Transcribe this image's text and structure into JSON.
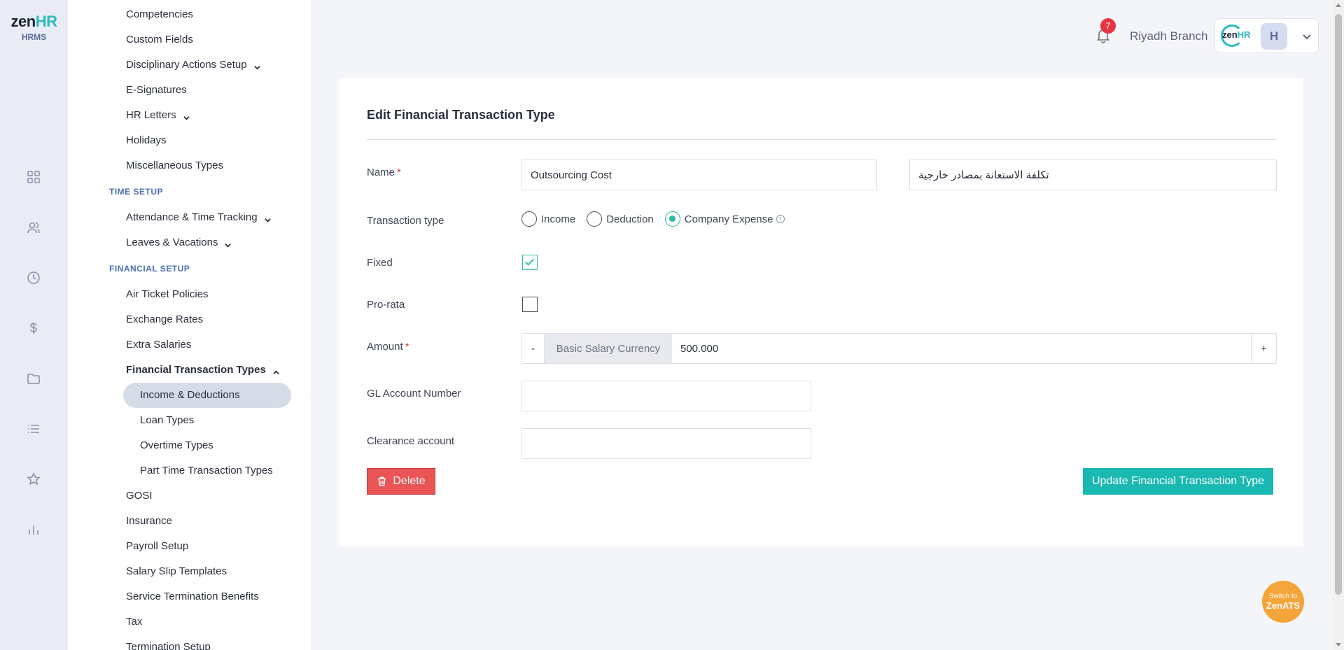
{
  "brand": {
    "logo_main": "zen",
    "logo_accent": "HR",
    "logo_sub": "HRMS"
  },
  "rail_icons": [
    "dashboard-icon",
    "people-icon",
    "clock-icon",
    "dollar-icon",
    "folder-icon",
    "list-icon",
    "star-icon",
    "bar-chart-icon"
  ],
  "sidebar": {
    "items": {
      "competencies": "Competencies",
      "custom_fields": "Custom Fields",
      "disciplinary": "Disciplinary Actions Setup",
      "e_signatures": "E-Signatures",
      "hr_letters": "HR Letters",
      "holidays": "Holidays",
      "misc_types": "Miscellaneous Types",
      "attendance": "Attendance & Time Tracking",
      "leaves": "Leaves & Vacations",
      "air_ticket": "Air Ticket Policies",
      "exchange_rates": "Exchange Rates",
      "extra_salaries": "Extra Salaries",
      "fin_trans_types": "Financial Transaction Types",
      "income_deductions": "Income & Deductions",
      "loan_types": "Loan Types",
      "overtime_types": "Overtime Types",
      "part_time": "Part Time Transaction Types",
      "gosi": "GOSI",
      "insurance": "Insurance",
      "payroll_setup": "Payroll Setup",
      "salary_slip": "Salary Slip Templates",
      "service_termination": "Service Termination Benefits",
      "tax": "Tax",
      "termination_setup": "Termination Setup"
    },
    "sections": {
      "time_setup": "TIME SETUP",
      "financial_setup": "FINANCIAL SETUP"
    }
  },
  "topbar": {
    "notification_count": "7",
    "branch": "Riyadh Branch",
    "avatar_initial": "H",
    "user_logo_main": "zen",
    "user_logo_accent": "HR"
  },
  "form": {
    "title": "Edit Financial Transaction Type",
    "name_label": "Name",
    "required_mark": "*",
    "name_en": "Outsourcing Cost",
    "name_ar": "تكلفة الاستعانة بمصادر خارجية",
    "transaction_type_label": "Transaction type",
    "transaction_options": [
      "Income",
      "Deduction",
      "Company Expense"
    ],
    "transaction_selected": "Company Expense",
    "info_glyph": "i",
    "fixed_label": "Fixed",
    "fixed_checked": true,
    "prorata_label": "Pro-rata",
    "prorata_checked": false,
    "amount_label": "Amount",
    "amount_minus": "-",
    "amount_plus": "+",
    "amount_currency": "Basic Salary Currency",
    "amount_value": "500.000",
    "gl_label": "GL Account Number",
    "gl_value": "",
    "clearance_label": "Clearance account",
    "clearance_value": "",
    "delete_label": "Delete",
    "update_label": "Update Financial Transaction Type"
  },
  "zenats": {
    "line1": "Switch to",
    "line2": "ZenATS"
  },
  "colors": {
    "accent": "#19b8b1",
    "danger": "#ea5455",
    "section": "#4c6fb1",
    "zenats": "#f5a43a"
  }
}
